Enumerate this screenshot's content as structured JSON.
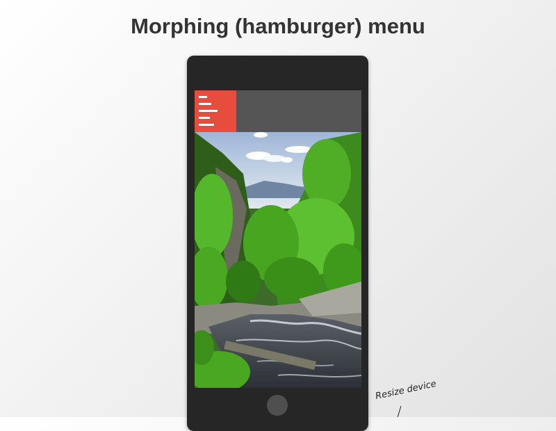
{
  "page": {
    "title": "Morphing (hamburger) menu"
  },
  "device": {
    "menu_icon": "hamburger-icon",
    "menu_color": "#e84c3d",
    "topbar_color": "#555555",
    "frame_color": "#262626"
  },
  "resize_hint": {
    "label": "Resize device"
  }
}
